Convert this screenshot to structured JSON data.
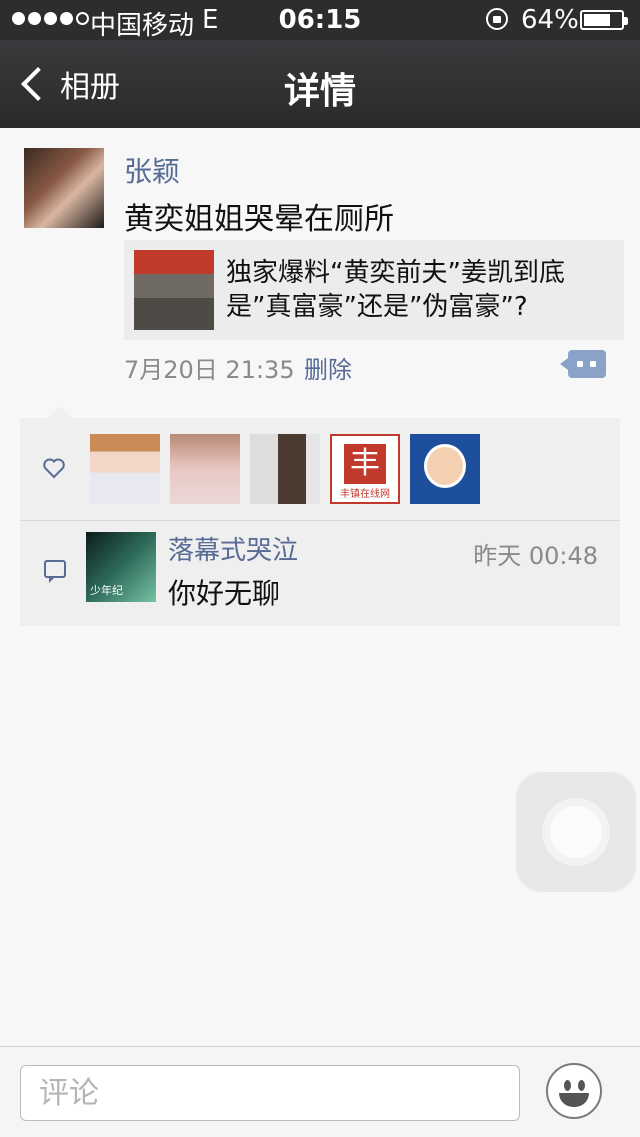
{
  "status_bar": {
    "carrier": "中国移动",
    "network": "E",
    "time": "06:15",
    "battery_percent": "64%",
    "battery_level": 0.64
  },
  "nav": {
    "back_label": "相册",
    "title": "详情"
  },
  "post": {
    "username": "张颖",
    "text": "黄奕姐姐哭晕在厕所",
    "link_title": "独家爆料“黄奕前夫”姜凯到底是”真富豪”还是”伪富豪”?",
    "time": "7月20日 21:35",
    "delete_label": "删除"
  },
  "comment": {
    "name": "落幕式哭泣",
    "time": "昨天 00:48",
    "text": "你好无聊",
    "avatar_tag": "少年纪"
  },
  "likers": {
    "l4_char": "丰",
    "l4_text": "丰镇在线网"
  },
  "input": {
    "placeholder": "评论"
  },
  "colors": {
    "link": "#576b95",
    "navbar": "#2d2d30"
  }
}
